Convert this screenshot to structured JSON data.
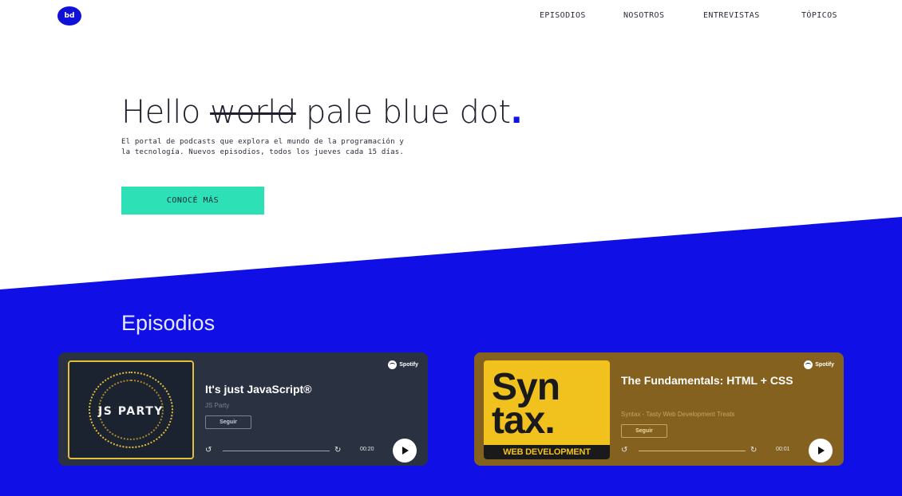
{
  "header": {
    "logo_text": "bd",
    "nav": [
      "EPISODIOS",
      "NOSOTROS",
      "ENTREVISTAS",
      "TÓPICOS"
    ]
  },
  "hero": {
    "title_start": "Hello ",
    "title_strike": "world",
    "title_end": " pale blue dot",
    "title_dot": ".",
    "subtitle_line1": "El portal de podcasts que explora el mundo de la programación y",
    "subtitle_line2": "la tecnología. Nuevos episodios, todos los jueves cada 15 días.",
    "cta_label": "CONOCÉ MÁS"
  },
  "episodes": {
    "section_title": "Episodios",
    "cards": [
      {
        "cover_text": "JS PARTY",
        "spotify_label": "Spotify",
        "title": "It's just JavaScript®",
        "show": "JS Party",
        "follow_label": "Seguir",
        "time": "00:20",
        "color": "#2a3140"
      },
      {
        "cover_word1": "Syn",
        "cover_word2": "tax.",
        "cover_banner": "WEB DEVELOPMENT",
        "spotify_label": "Spotify",
        "title": "The Fundamentals: HTML + CSS",
        "show": "Syntax - Tasty Web Development Treats",
        "follow_label": "Seguir",
        "time": "00:01",
        "color": "#84611e"
      }
    ]
  },
  "colors": {
    "blue": "#0f0fe6",
    "cta": "#2de0b6"
  }
}
